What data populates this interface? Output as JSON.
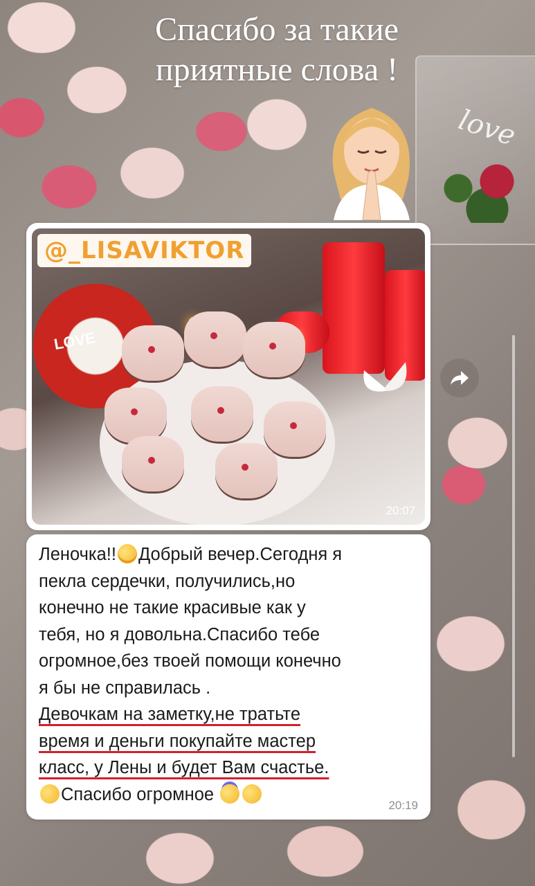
{
  "headline": {
    "line1": "Спасибо за такие",
    "line2": "приятные слова !"
  },
  "decor": {
    "candle_box_word": "love",
    "candy_label": "LOVE"
  },
  "post": {
    "handle": "@_LISAVIKTOR",
    "time": "20:07"
  },
  "message": {
    "lines": [
      "Леночка!!",
      "Добрый вечер.Сегодня я",
      "пекла сердечки, получились,но",
      "конечно не такие красивые как у",
      "тебя, но я довольна.Спасибо тебе",
      "огромное,без твоей помощи конечно",
      "я бы не справилась  .",
      "Девочкам на заметку,не тратьте",
      "время и деньги покупайте мастер",
      "класс, у Лены и  будет Вам счастье.",
      "Спасибо огромное"
    ],
    "time": "20:19",
    "emojis": [
      "smiling-face-with-hearts",
      "face-blowing-kiss",
      "partying-face",
      "hugging-face"
    ]
  },
  "colors": {
    "accent_handle": "#f0a030",
    "underline": "#d31f2a",
    "bubble": "#ffffff"
  }
}
